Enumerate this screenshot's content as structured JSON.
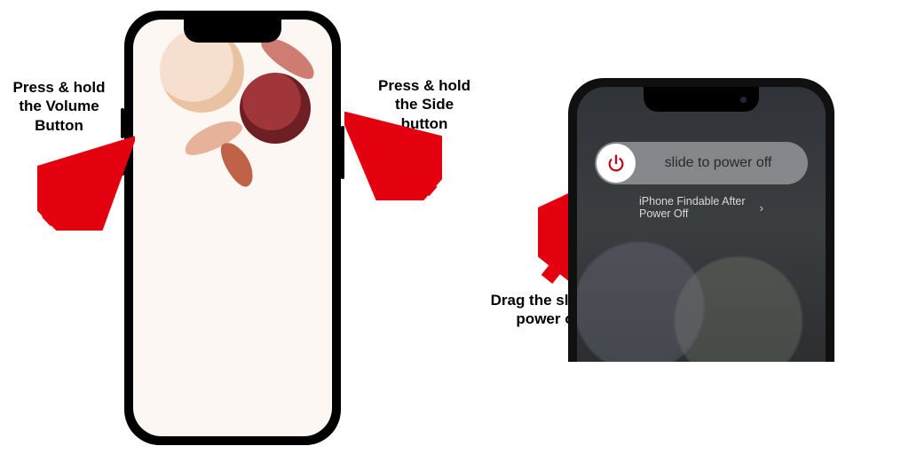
{
  "annotations": {
    "volume": "Press & hold\nthe Volume\nButton",
    "side": "Press & hold\nthe Side button",
    "drag": "Drag the slider to\npower offf"
  },
  "power_screen": {
    "slider_label": "slide to power off",
    "findable_label": "iPhone Findable After Power Off"
  },
  "colors": {
    "arrow": "#e3000f",
    "power_icon": "#e3000f"
  }
}
